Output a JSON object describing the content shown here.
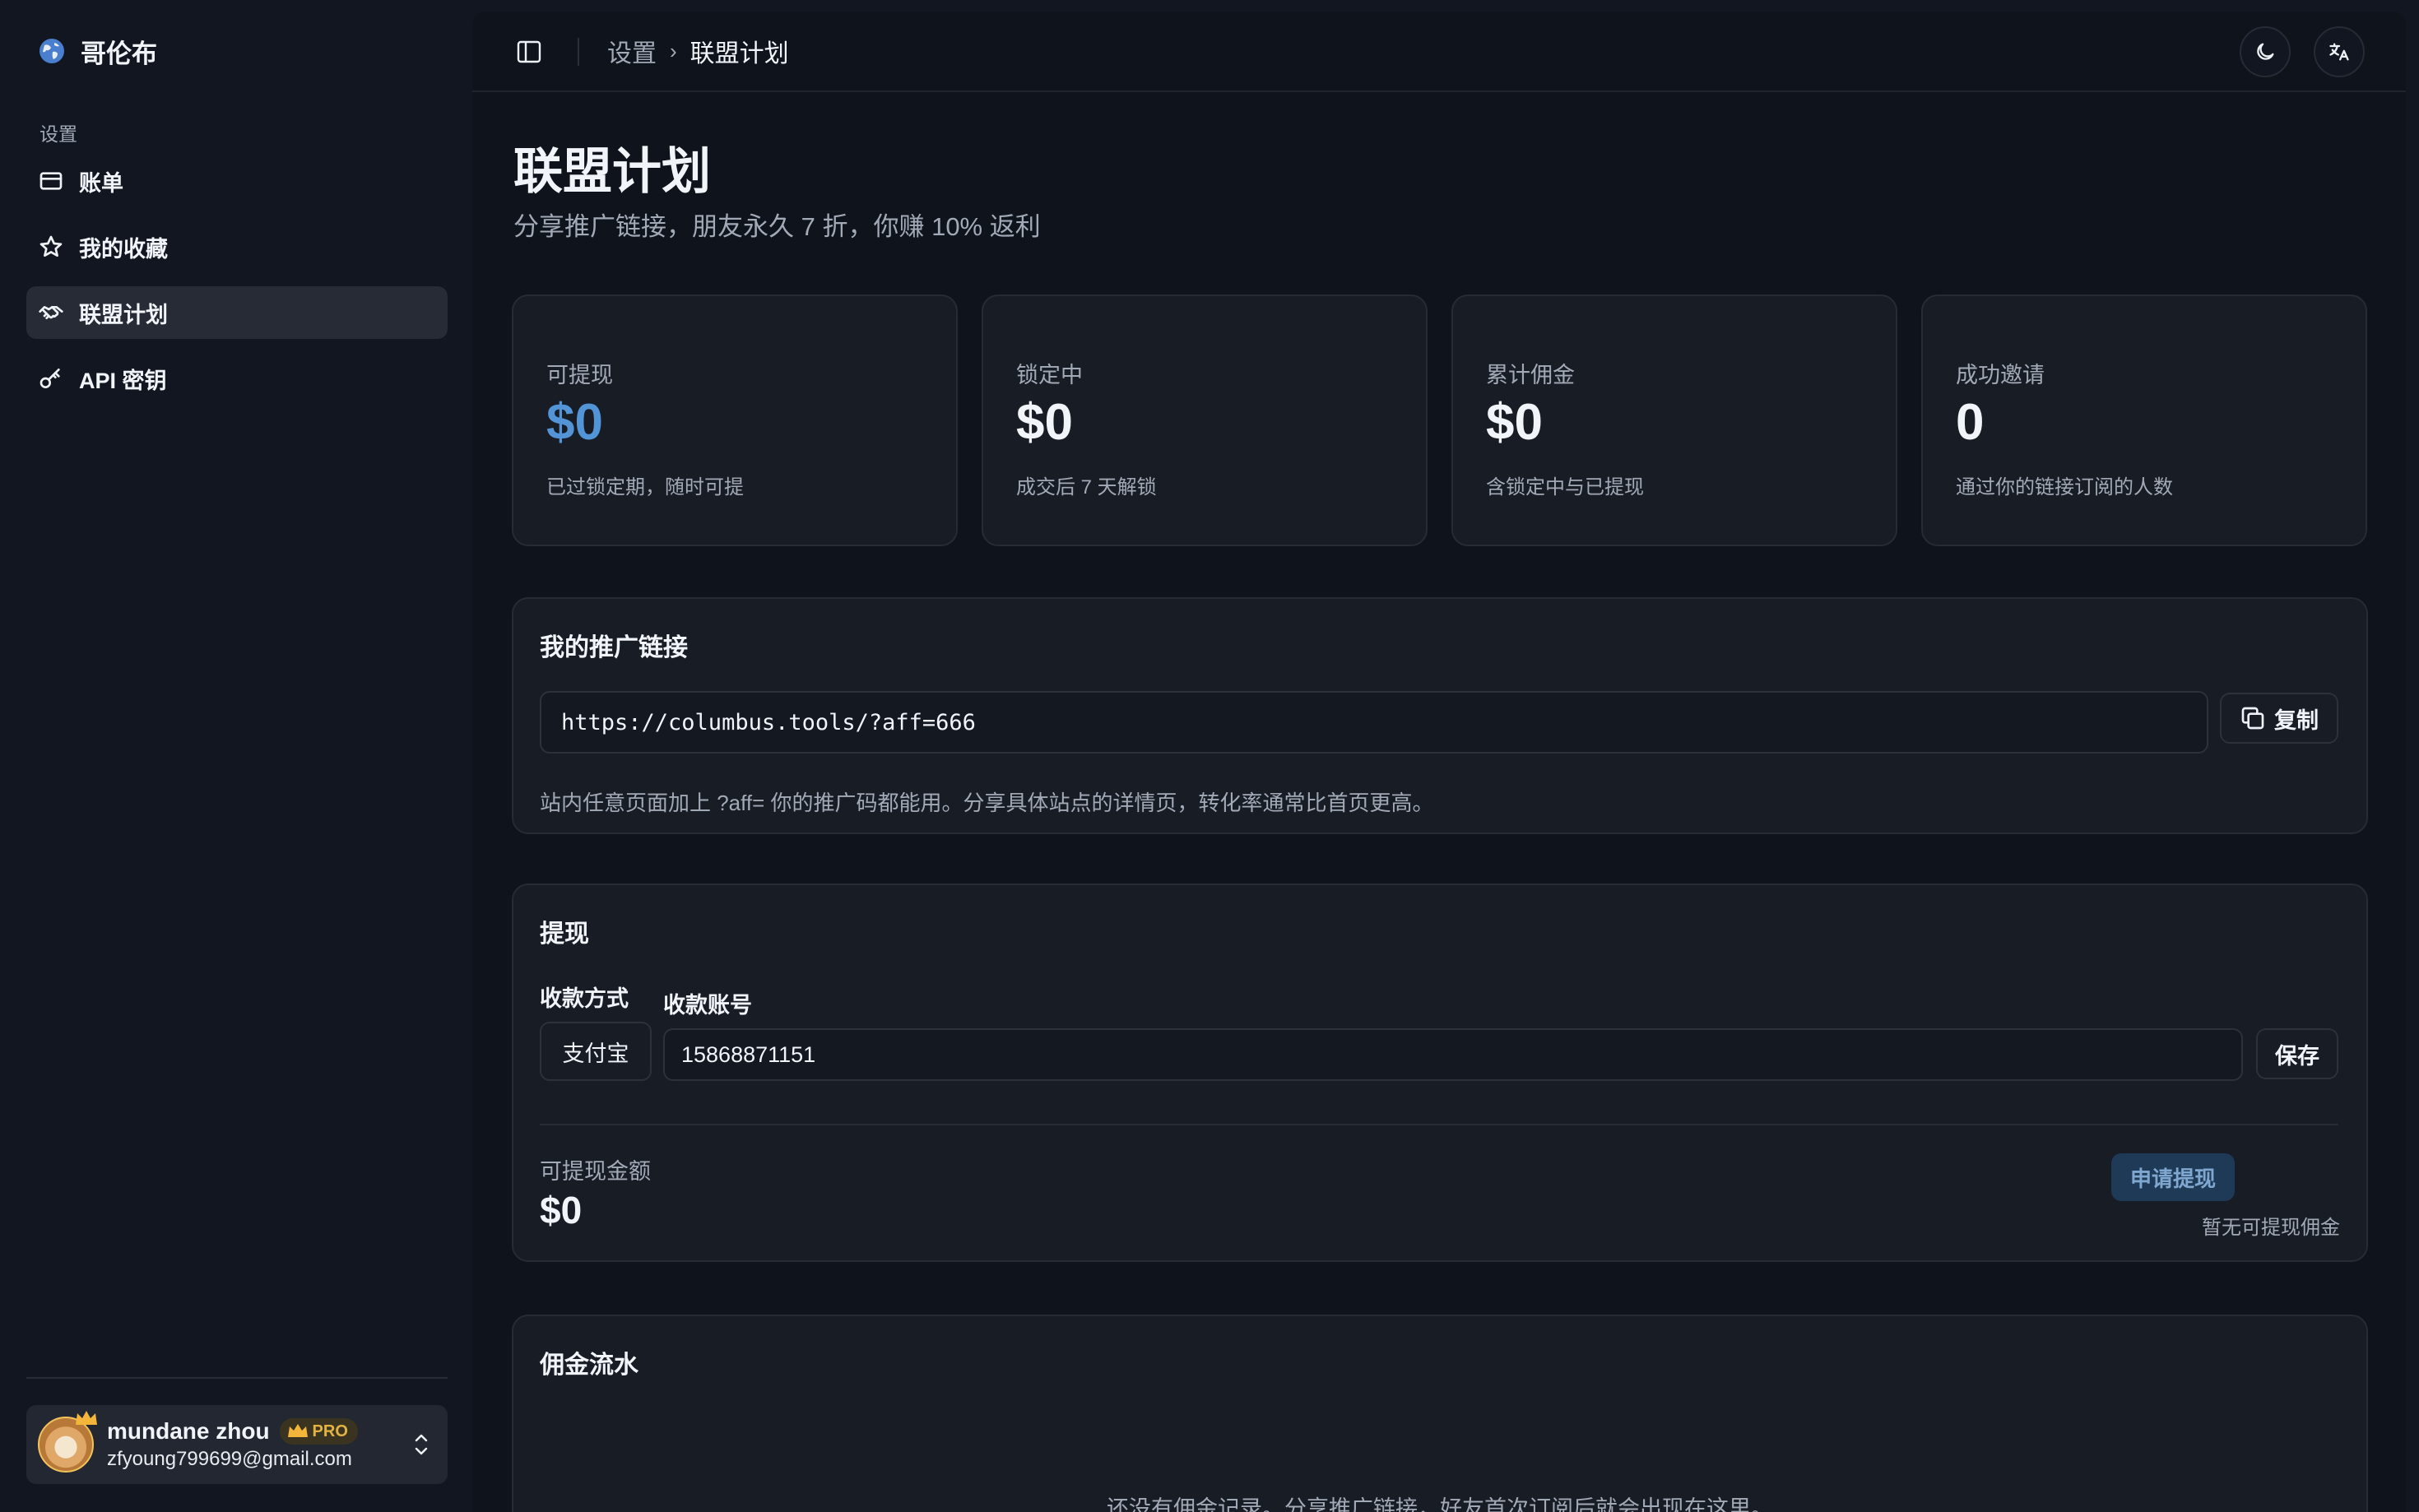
{
  "brand": {
    "name": "哥伦布"
  },
  "sidebar": {
    "section_label": "设置",
    "items": [
      {
        "label": "账单",
        "icon": "credit-card-icon",
        "active": false
      },
      {
        "label": "我的收藏",
        "icon": "star-icon",
        "active": false
      },
      {
        "label": "联盟计划",
        "icon": "handshake-icon",
        "active": true
      },
      {
        "label": "API 密钥",
        "icon": "key-icon",
        "active": false
      }
    ],
    "user": {
      "name": "mundane zhou",
      "badge": "PRO",
      "email": "zfyoung799699@gmail.com"
    }
  },
  "topbar": {
    "breadcrumb_parent": "设置",
    "breadcrumb_sep": "›",
    "breadcrumb_current": "联盟计划"
  },
  "page": {
    "title": "联盟计划",
    "subtitle": "分享推广链接，朋友永久 7 折，你赚 10% 返利"
  },
  "stats": [
    {
      "label": "可提现",
      "value": "$0",
      "note": "已过锁定期，随时可提",
      "accent_color": "#5294d6"
    },
    {
      "label": "锁定中",
      "value": "$0",
      "note": "成交后 7 天解锁"
    },
    {
      "label": "累计佣金",
      "value": "$0",
      "note": "含锁定中与已提现"
    },
    {
      "label": "成功邀请",
      "value": "0",
      "note": "通过你的链接订阅的人数"
    }
  ],
  "referral": {
    "title": "我的推广链接",
    "link": "https://columbus.tools/?aff=666",
    "copy_label": "复制",
    "hint": "站内任意页面加上 ?aff= 你的推广码都能用。分享具体站点的详情页，转化率通常比首页更高。"
  },
  "withdraw": {
    "title": "提现",
    "method_label": "收款方式",
    "method_value": "支付宝",
    "account_label": "收款账号",
    "account_value": "15868871151",
    "save_label": "保存",
    "available_label": "可提现金额",
    "available_value": "$0",
    "apply_label": "申请提现",
    "apply_note": "暂无可提现佣金"
  },
  "commission": {
    "title": "佣金流水",
    "empty_text": "还没有佣金记录。分享推广链接，好友首次订阅后就会出现在这里。"
  }
}
